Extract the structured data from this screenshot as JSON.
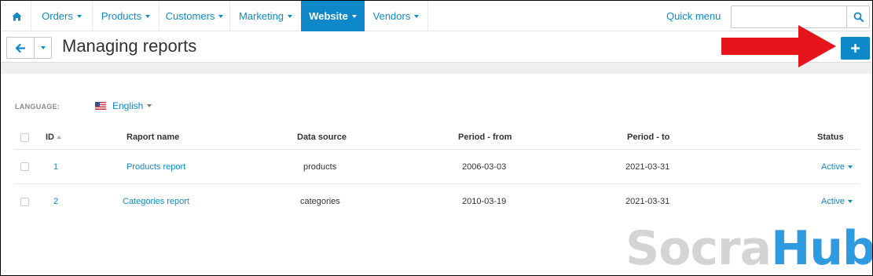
{
  "nav": {
    "items": [
      {
        "label": "Orders"
      },
      {
        "label": "Products"
      },
      {
        "label": "Customers"
      },
      {
        "label": "Marketing"
      },
      {
        "label": "Website"
      },
      {
        "label": "Vendors"
      }
    ],
    "active": "Website",
    "quick_menu": "Quick menu",
    "search_value": ""
  },
  "header": {
    "title": "Managing reports"
  },
  "language": {
    "label": "LANGUAGE:",
    "value": "English"
  },
  "table": {
    "columns": [
      "ID",
      "Raport name",
      "Data source",
      "Period - from",
      "Period - to",
      "Status"
    ],
    "rows": [
      {
        "id": "1",
        "name": "Products report",
        "source": "products",
        "from": "2006-03-03",
        "to": "2021-03-31",
        "status": "Active"
      },
      {
        "id": "2",
        "name": "Categories report",
        "source": "categories",
        "from": "2010-03-19",
        "to": "2021-03-31",
        "status": "Active"
      }
    ]
  },
  "watermark": {
    "part1": "Socra",
    "part2": "Hub"
  },
  "colors": {
    "accent": "#0e88c9",
    "arrow": "#e8141b",
    "link": "#0f8ac8"
  },
  "icons": [
    "home-icon",
    "search-icon",
    "back-arrow-icon",
    "plus-icon",
    "us-flag-icon"
  ]
}
